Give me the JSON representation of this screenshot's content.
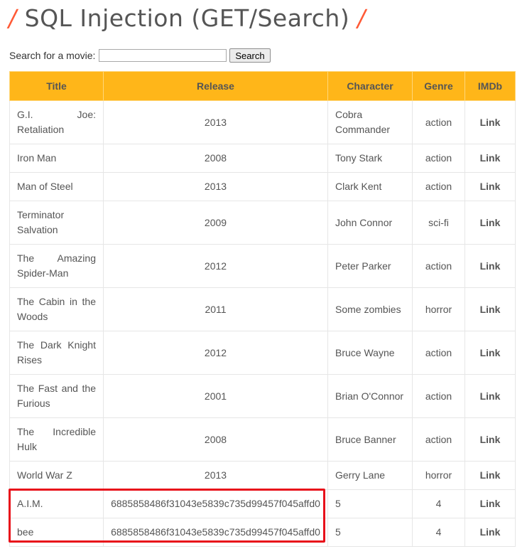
{
  "page": {
    "title": "SQL Injection (GET/Search)",
    "slash_left": "/",
    "slash_right": "/"
  },
  "search": {
    "label": "Search for a movie:",
    "value": "",
    "button_label": "Search"
  },
  "table": {
    "headers": [
      "Title",
      "Release",
      "Character",
      "Genre",
      "IMDb"
    ],
    "rows": [
      {
        "title": "G.I. Joe: Retaliation",
        "release": "2013",
        "character": "Cobra Commander",
        "genre": "action",
        "imdb": "Link"
      },
      {
        "title": "Iron Man",
        "release": "2008",
        "character": "Tony Stark",
        "genre": "action",
        "imdb": "Link"
      },
      {
        "title": "Man of Steel",
        "release": "2013",
        "character": "Clark Kent",
        "genre": "action",
        "imdb": "Link"
      },
      {
        "title": "Terminator Salvation",
        "release": "2009",
        "character": "John Connor",
        "genre": "sci-fi",
        "imdb": "Link"
      },
      {
        "title": "The Amazing Spider-Man",
        "release": "2012",
        "character": "Peter Parker",
        "genre": "action",
        "imdb": "Link"
      },
      {
        "title": "The Cabin in the Woods",
        "release": "2011",
        "character": "Some zombies",
        "genre": "horror",
        "imdb": "Link"
      },
      {
        "title": "The Dark Knight Rises",
        "release": "2012",
        "character": "Bruce Wayne",
        "genre": "action",
        "imdb": "Link"
      },
      {
        "title": "The Fast and the Furious",
        "release": "2001",
        "character": "Brian O'Connor",
        "genre": "action",
        "imdb": "Link"
      },
      {
        "title": "The Incredible Hulk",
        "release": "2008",
        "character": "Bruce Banner",
        "genre": "action",
        "imdb": "Link"
      },
      {
        "title": "World War Z",
        "release": "2013",
        "character": "Gerry Lane",
        "genre": "horror",
        "imdb": "Link"
      },
      {
        "title": "A.I.M.",
        "release": "6885858486f31043e5839c735d99457f045affd0",
        "character": "5",
        "genre": "4",
        "imdb": "Link"
      },
      {
        "title": "bee",
        "release": "6885858486f31043e5839c735d99457f045affd0",
        "character": "5",
        "genre": "4",
        "imdb": "Link"
      }
    ]
  },
  "colors": {
    "header_bg": "#ffb619",
    "title_slash": "#ff5a36",
    "highlight_box": "#e8101a"
  }
}
